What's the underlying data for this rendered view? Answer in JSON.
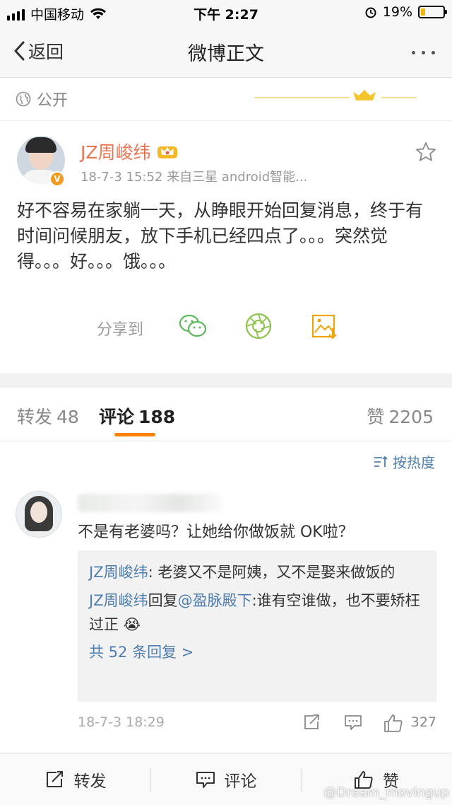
{
  "status_bar": {
    "carrier": "中国移动",
    "time": "下午 2:27",
    "battery": "19%",
    "battery_level": 0.19
  },
  "nav": {
    "back_label": "返回",
    "title": "微博正文"
  },
  "visibility": "公开",
  "post": {
    "author": "JZ周峻纬",
    "meta": "18-7-3 15:52  来自三星 android智能...",
    "text": "好不容易在家躺一天，从睁眼开始回复消息，终于有时间问候朋友，放下手机已经四点了。。。突然觉得。。。好。。。饿。。。",
    "share_label": "分享到"
  },
  "tabs": {
    "repost_label": "转发",
    "repost_count": "48",
    "comment_label": "评论",
    "comment_count": "188",
    "like_label": "赞",
    "like_count": "2205"
  },
  "sort_label": "按热度",
  "comment": {
    "text": "不是有老婆吗？让她给你做饭就 OK啦？",
    "replies": [
      {
        "name": "JZ周峻纬",
        "text": ": 老婆又不是阿姨，又不是娶来做饭的"
      },
      {
        "name": "JZ周峻纬",
        "text": "回复",
        "mention": "@盈脉殿下",
        "text2": ":谁有空谁做，也不要矫枉过正 😭"
      }
    ],
    "more_replies": "共 52 条回复 >",
    "time": "18-7-3 18:29",
    "likes": "327"
  },
  "toolbar": {
    "repost": "转发",
    "comment": "评论",
    "like": "赞"
  },
  "watermark": "@Dream_movingup",
  "colors": {
    "accent": "#ff8200",
    "author": "#eb7350",
    "link": "#507daf"
  }
}
